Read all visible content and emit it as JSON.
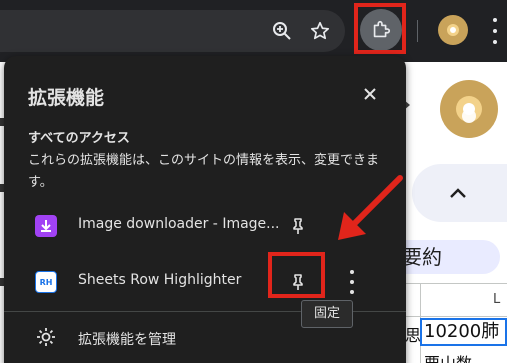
{
  "popup": {
    "title": "拡張機能",
    "section_title": "すべてのアクセス",
    "section_desc": "これらの拡張機能は、このサイトの情報を表示、変更できます。",
    "extensions": [
      {
        "name": "Image downloader - Image...",
        "icon": "download-icon",
        "icon_color": "#a142f4"
      },
      {
        "name": "Sheets Row Highlighter",
        "icon": "rh-icon",
        "icon_label": "RH",
        "icon_color": "#1a73e8"
      }
    ],
    "manage_label": "拡張機能を管理"
  },
  "tooltip": {
    "text": "固定"
  },
  "page": {
    "summary_label": "要約",
    "col_header": "L",
    "cell_left": "思",
    "cell_value": "10200肺",
    "cell_bottom": "要山数"
  },
  "colors": {
    "highlight_red": "#e1251b",
    "popup_bg": "#1f1f1f",
    "toolbar_bg": "#202124"
  }
}
